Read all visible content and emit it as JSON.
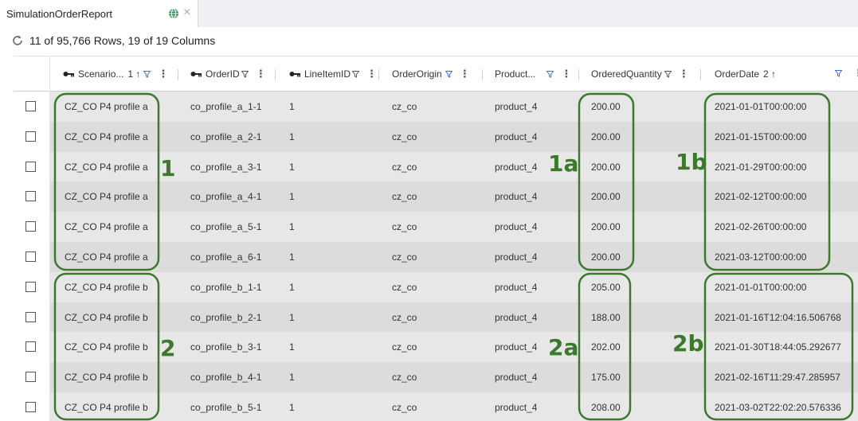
{
  "tab": {
    "title": "SimulationOrderReport",
    "globe_icon": "globe-icon",
    "close": "×"
  },
  "status": {
    "text": "11 of 95,766 Rows, 19 of 19 Columns",
    "icon": "refresh-icon"
  },
  "columns": [
    {
      "label": "Scenario...",
      "sort": "1 ↑",
      "key": true
    },
    {
      "label": "OrderID",
      "sort": "",
      "key": true
    },
    {
      "label": "LineItemID",
      "sort": "",
      "key": true
    },
    {
      "label": "OrderOrigin",
      "sort": "",
      "key": false
    },
    {
      "label": "Product...",
      "sort": "",
      "key": false
    },
    {
      "label": "OrderedQuantity",
      "sort": "",
      "key": false
    },
    {
      "label": "OrderDate",
      "sort": "2 ↑",
      "key": false
    }
  ],
  "rows": [
    {
      "scenario": "CZ_CO P4 profile a",
      "order_id": "co_profile_a_1-1",
      "line_item": "1",
      "origin": "cz_co",
      "product": "product_4",
      "quantity": "200.00",
      "date": "2021-01-01T00:00:00"
    },
    {
      "scenario": "CZ_CO P4 profile a",
      "order_id": "co_profile_a_2-1",
      "line_item": "1",
      "origin": "cz_co",
      "product": "product_4",
      "quantity": "200.00",
      "date": "2021-01-15T00:00:00"
    },
    {
      "scenario": "CZ_CO P4 profile a",
      "order_id": "co_profile_a_3-1",
      "line_item": "1",
      "origin": "cz_co",
      "product": "product_4",
      "quantity": "200.00",
      "date": "2021-01-29T00:00:00"
    },
    {
      "scenario": "CZ_CO P4 profile a",
      "order_id": "co_profile_a_4-1",
      "line_item": "1",
      "origin": "cz_co",
      "product": "product_4",
      "quantity": "200.00",
      "date": "2021-02-12T00:00:00"
    },
    {
      "scenario": "CZ_CO P4 profile a",
      "order_id": "co_profile_a_5-1",
      "line_item": "1",
      "origin": "cz_co",
      "product": "product_4",
      "quantity": "200.00",
      "date": "2021-02-26T00:00:00"
    },
    {
      "scenario": "CZ_CO P4 profile a",
      "order_id": "co_profile_a_6-1",
      "line_item": "1",
      "origin": "cz_co",
      "product": "product_4",
      "quantity": "200.00",
      "date": "2021-03-12T00:00:00"
    },
    {
      "scenario": "CZ_CO P4 profile b",
      "order_id": "co_profile_b_1-1",
      "line_item": "1",
      "origin": "cz_co",
      "product": "product_4",
      "quantity": "205.00",
      "date": "2021-01-01T00:00:00"
    },
    {
      "scenario": "CZ_CO P4 profile b",
      "order_id": "co_profile_b_2-1",
      "line_item": "1",
      "origin": "cz_co",
      "product": "product_4",
      "quantity": "188.00",
      "date": "2021-01-16T12:04:16.506768"
    },
    {
      "scenario": "CZ_CO P4 profile b",
      "order_id": "co_profile_b_3-1",
      "line_item": "1",
      "origin": "cz_co",
      "product": "product_4",
      "quantity": "202.00",
      "date": "2021-01-30T18:44:05.292677"
    },
    {
      "scenario": "CZ_CO P4 profile b",
      "order_id": "co_profile_b_4-1",
      "line_item": "1",
      "origin": "cz_co",
      "product": "product_4",
      "quantity": "175.00",
      "date": "2021-02-16T11:29:47.285957"
    },
    {
      "scenario": "CZ_CO P4 profile b",
      "order_id": "co_profile_b_5-1",
      "line_item": "1",
      "origin": "cz_co",
      "product": "product_4",
      "quantity": "208.00",
      "date": "2021-03-02T22:02:20.576336"
    }
  ],
  "annotations": [
    "1",
    "1a",
    "1b",
    "2",
    "2a",
    "2b"
  ],
  "colors": {
    "annotation_green": "#3b7a2c",
    "filter_blue": "#3a6fd8",
    "row_bg": "#e7e7e7",
    "row_alt_bg": "#dcdcdc"
  }
}
